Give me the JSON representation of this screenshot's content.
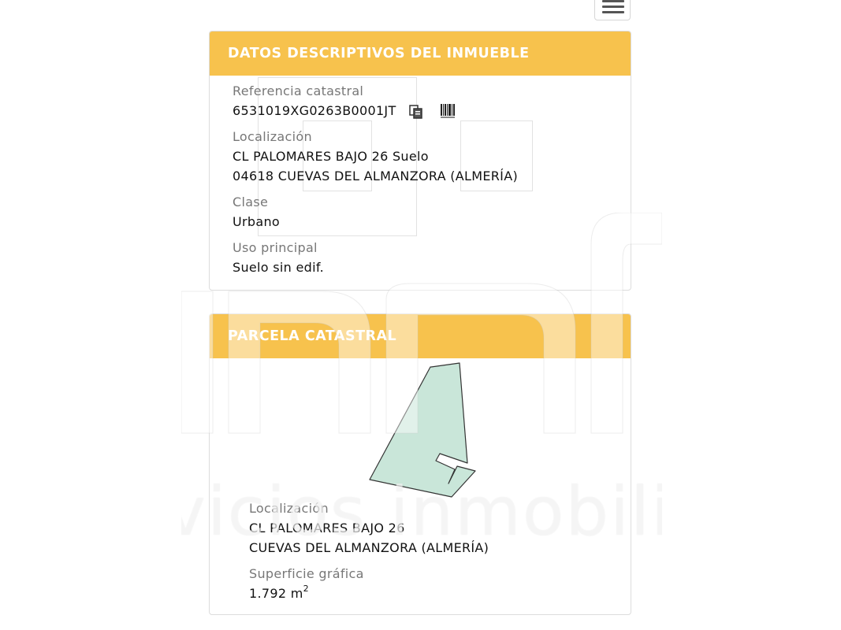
{
  "menu": {
    "icon": "hamburger-menu-icon"
  },
  "descriptive_panel": {
    "title": "DATOS DESCRIPTIVOS DEL INMUEBLE",
    "reference_label": "Referencia catastral",
    "reference_value": "6531019XG0263B0001JT",
    "copy_icon": "copy-icon",
    "barcode_icon": "barcode-icon",
    "location_label": "Localización",
    "location_line1": "CL PALOMARES BAJO 26 Suelo",
    "location_line2": "04618 CUEVAS DEL ALMANZORA (ALMERÍA)",
    "class_label": "Clase",
    "class_value": "Urbano",
    "use_label": "Uso principal",
    "use_value": "Suelo sin edif."
  },
  "parcel_panel": {
    "title": "PARCELA CATASTRAL",
    "location_label": "Localización",
    "location_line1": "CL PALOMARES BAJO 26",
    "location_line2": "CUEVAS DEL ALMANZORA (ALMERÍA)",
    "area_label": "Superficie gráfica",
    "area_value": "1.792 m",
    "area_unit_exp": "2"
  },
  "watermark": {
    "text": "vicios inmobilia"
  },
  "colors": {
    "header": "#f7c24d",
    "parcel_fill": "#c9e6d9",
    "parcel_stroke": "#333333"
  }
}
